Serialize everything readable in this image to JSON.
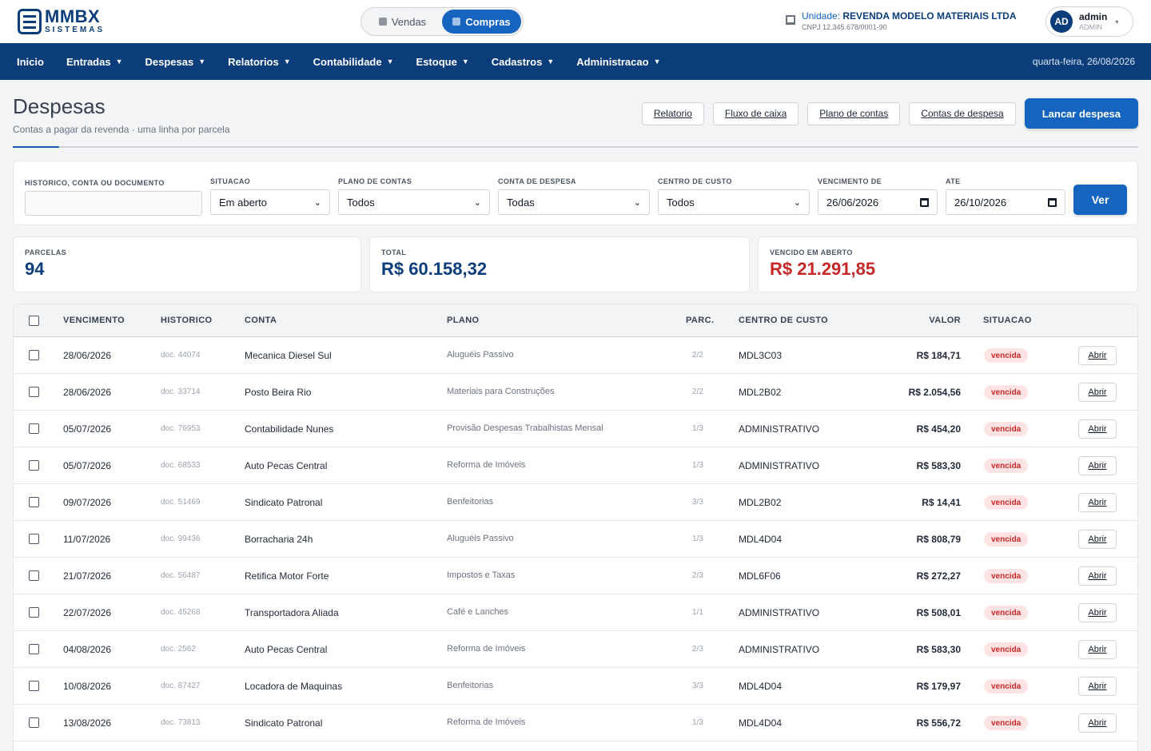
{
  "brand": {
    "name": "MMBX",
    "sub": "SISTEMAS"
  },
  "mode_switch": {
    "vendas": "Vendas",
    "compras": "Compras",
    "active": "compras"
  },
  "unit": {
    "prefix": "Unidade:",
    "name": "REVENDA MODELO MATERIAIS LTDA",
    "cnpj": "CNPJ 12.345.678/0001-90"
  },
  "user": {
    "initials": "AD",
    "name": "admin",
    "role": "ADMIN"
  },
  "nav": {
    "items": [
      {
        "label": "Inicio",
        "has_menu": false
      },
      {
        "label": "Entradas",
        "has_menu": true
      },
      {
        "label": "Despesas",
        "has_menu": true
      },
      {
        "label": "Relatorios",
        "has_menu": true
      },
      {
        "label": "Contabilidade",
        "has_menu": true
      },
      {
        "label": "Estoque",
        "has_menu": true
      },
      {
        "label": "Cadastros",
        "has_menu": true
      },
      {
        "label": "Administracao",
        "has_menu": true
      }
    ],
    "date": "quarta-feira, 26/08/2026"
  },
  "page": {
    "title": "Despesas",
    "subtitle": "Contas a pagar da revenda · uma linha por parcela",
    "actions": [
      "Relatorio",
      "Fluxo de caixa",
      "Plano de contas",
      "Contas de despesa"
    ],
    "primary_action": "Lancar despesa"
  },
  "filters": {
    "search_label": "HISTORICO, CONTA OU DOCUMENTO",
    "search_value": "",
    "situacao_label": "SITUACAO",
    "situacao_value": "Em aberto",
    "plano_label": "PLANO DE CONTAS",
    "plano_value": "Todos",
    "conta_label": "CONTA DE DESPESA",
    "conta_value": "Todas",
    "centro_label": "CENTRO DE CUSTO",
    "centro_value": "Todos",
    "venc_de_label": "VENCIMENTO DE",
    "venc_de_value": "26/06/2026",
    "ate_label": "ATE",
    "ate_value": "26/10/2026",
    "submit_label": "Ver"
  },
  "summary": {
    "parcelas_label": "PARCELAS",
    "parcelas_value": "94",
    "total_label": "TOTAL",
    "total_value": "R$ 60.158,32",
    "vencido_label": "VENCIDO EM ABERTO",
    "vencido_value": "R$ 21.291,85"
  },
  "table": {
    "headers": {
      "vencimento": "VENCIMENTO",
      "historico": "HISTORICO",
      "conta": "CONTA",
      "plano": "PLANO",
      "parc": "PARC.",
      "centro": "CENTRO DE CUSTO",
      "valor": "VALOR",
      "situacao": "SITUACAO"
    },
    "open_label": "Abrir",
    "rows": [
      {
        "venc": "28/06/2026",
        "doc": "doc. 44074",
        "conta": "Mecanica Diesel Sul",
        "plano": "Aluguéis Passivo",
        "parc": "2/2",
        "centro": "MDL3C03",
        "valor": "R$ 184,71",
        "situacao": "vencida"
      },
      {
        "venc": "28/06/2026",
        "doc": "doc. 33714",
        "conta": "Posto Beira Rio",
        "plano": "Materiais para Construções",
        "parc": "2/2",
        "centro": "MDL2B02",
        "valor": "R$ 2.054,56",
        "situacao": "vencida"
      },
      {
        "venc": "05/07/2026",
        "doc": "doc. 76953",
        "conta": "Contabilidade Nunes",
        "plano": "Provisão Despesas Trabalhistas Mensal",
        "parc": "1/3",
        "centro": "ADMINISTRATIVO",
        "valor": "R$ 454,20",
        "situacao": "vencida"
      },
      {
        "venc": "05/07/2026",
        "doc": "doc. 68533",
        "conta": "Auto Pecas Central",
        "plano": "Reforma de Imóveis",
        "parc": "1/3",
        "centro": "ADMINISTRATIVO",
        "valor": "R$ 583,30",
        "situacao": "vencida"
      },
      {
        "venc": "09/07/2026",
        "doc": "doc. 51469",
        "conta": "Sindicato Patronal",
        "plano": "Benfeitorias",
        "parc": "3/3",
        "centro": "MDL2B02",
        "valor": "R$ 14,41",
        "situacao": "vencida"
      },
      {
        "venc": "11/07/2026",
        "doc": "doc. 99436",
        "conta": "Borracharia 24h",
        "plano": "Aluguéis Passivo",
        "parc": "1/3",
        "centro": "MDL4D04",
        "valor": "R$ 808,79",
        "situacao": "vencida"
      },
      {
        "venc": "21/07/2026",
        "doc": "doc. 56487",
        "conta": "Retifica Motor Forte",
        "plano": "Impostos e Taxas",
        "parc": "2/3",
        "centro": "MDL6F06",
        "valor": "R$ 272,27",
        "situacao": "vencida"
      },
      {
        "venc": "22/07/2026",
        "doc": "doc. 45268",
        "conta": "Transportadora Aliada",
        "plano": "Café e Lanches",
        "parc": "1/1",
        "centro": "ADMINISTRATIVO",
        "valor": "R$ 508,01",
        "situacao": "vencida"
      },
      {
        "venc": "04/08/2026",
        "doc": "doc. 2562",
        "conta": "Auto Pecas Central",
        "plano": "Reforma de Imóveis",
        "parc": "2/3",
        "centro": "ADMINISTRATIVO",
        "valor": "R$ 583,30",
        "situacao": "vencida"
      },
      {
        "venc": "10/08/2026",
        "doc": "doc. 87427",
        "conta": "Locadora de Maquinas",
        "plano": "Benfeitorias",
        "parc": "3/3",
        "centro": "MDL4D04",
        "valor": "R$ 179,97",
        "situacao": "vencida"
      },
      {
        "venc": "13/08/2026",
        "doc": "doc. 73813",
        "conta": "Sindicato Patronal",
        "plano": "Reforma de Imóveis",
        "parc": "1/3",
        "centro": "MDL4D04",
        "valor": "R$ 556,72",
        "situacao": "vencida"
      }
    ]
  }
}
